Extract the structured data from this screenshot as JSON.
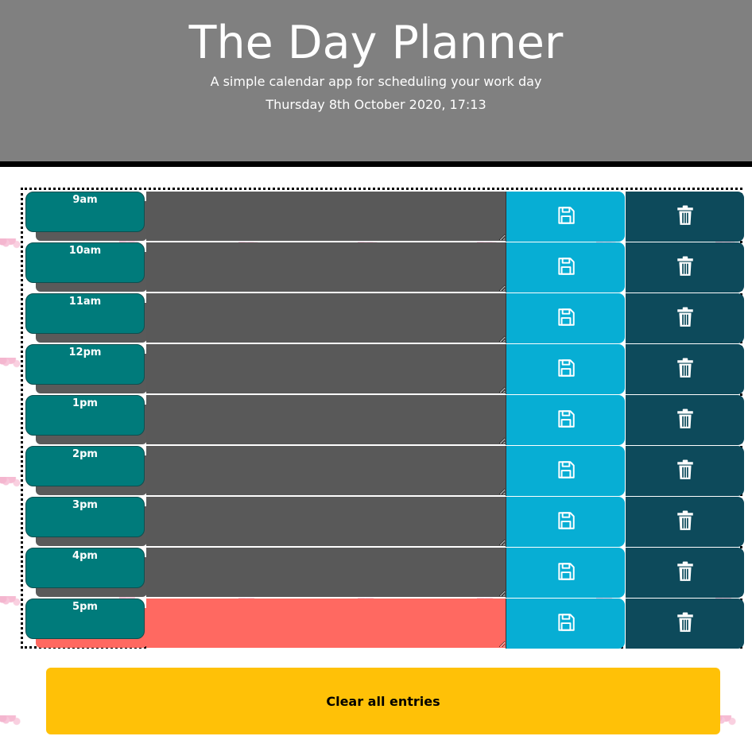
{
  "header": {
    "title": "The Day Planner",
    "subtitle": "A simple calendar app for scheduling your work day",
    "datetime": "Thursday 8th October 2020, 17:13"
  },
  "rows": [
    {
      "hour": "9am",
      "entry": "",
      "state": "past"
    },
    {
      "hour": "10am",
      "entry": "",
      "state": "past"
    },
    {
      "hour": "11am",
      "entry": "",
      "state": "past"
    },
    {
      "hour": "12pm",
      "entry": "",
      "state": "past"
    },
    {
      "hour": "1pm",
      "entry": "",
      "state": "past"
    },
    {
      "hour": "2pm",
      "entry": "",
      "state": "past"
    },
    {
      "hour": "3pm",
      "entry": "",
      "state": "past"
    },
    {
      "hour": "4pm",
      "entry": "",
      "state": "past"
    },
    {
      "hour": "5pm",
      "entry": "",
      "state": "present"
    }
  ],
  "icons": {
    "save": "floppy-disk-icon",
    "delete": "trash-can-icon"
  },
  "colors": {
    "hour": "#007b7b",
    "past": "#595959",
    "present": "#ff6961",
    "save": "#07aed4",
    "delete": "#0d4a5b",
    "clear": "#ffc107"
  },
  "clear_label": "Clear all entries"
}
